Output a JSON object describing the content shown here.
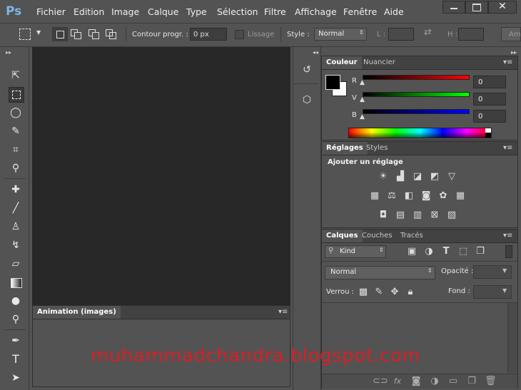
{
  "app": {
    "logo": "Ps"
  },
  "menu": [
    "Fichier",
    "Edition",
    "Image",
    "Calque",
    "Type",
    "Sélection",
    "Filtre",
    "Affichage",
    "Fenêtre",
    "Aide"
  ],
  "options": {
    "feather_label": "Contour progr. :",
    "feather_value": "0 px",
    "antialias_label": "Lissage",
    "style_label": "Style :",
    "style_value": "Normal",
    "width_label": "L :",
    "height_label": "H :",
    "refine_label": "Am"
  },
  "color_panel": {
    "tabs": [
      "Couleur",
      "Nuancier"
    ],
    "channels": [
      {
        "label": "R",
        "value": "0"
      },
      {
        "label": "V",
        "value": "0"
      },
      {
        "label": "B",
        "value": "0"
      }
    ],
    "colors": {
      "r_track": "#ff0000",
      "g_track": "#00ff00",
      "b_track": "#0000ff",
      "foreground": "#000000",
      "background": "#ffffff"
    }
  },
  "adjustments_panel": {
    "tabs": [
      "Réglages",
      "Styles"
    ],
    "heading": "Ajouter un réglage",
    "icons": [
      "brightness-icon",
      "levels-icon",
      "curves-icon",
      "exposure-icon",
      "vibrance-icon",
      "hue-saturation-icon",
      "color-balance-icon",
      "black-white-icon",
      "photo-filter-icon",
      "channel-mixer-icon",
      "color-lookup-icon",
      "invert-icon",
      "posterize-icon",
      "threshold-icon",
      "selective-color-icon",
      "gradient-map-icon"
    ]
  },
  "layers_panel": {
    "tabs": [
      "Calques",
      "Couches",
      "Tracés"
    ],
    "filter_value": "Kind",
    "blend_mode": "Normal",
    "opacity_label": "Opacité :",
    "lock_label": "Verrou :",
    "fill_label": "Fond :"
  },
  "animation_panel": {
    "tab": "Animation (images)"
  },
  "watermark": "muhammadchandra.blogspot.com"
}
